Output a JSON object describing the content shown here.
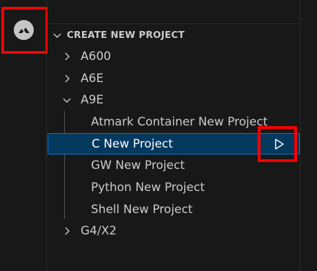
{
  "colors": {
    "background": "#181818",
    "text": "#cccccc",
    "selection_bg": "#04395e",
    "selection_border": "#0078d4",
    "annotation": "#ff0000"
  },
  "activity_bar": {
    "icon": "atmark-dev-icon"
  },
  "section": {
    "title": "CREATE NEW PROJECT",
    "icon": "chevron-down-icon"
  },
  "tree": [
    {
      "label": "A600",
      "expanded": false,
      "icon": "chevron-right-icon"
    },
    {
      "label": "A6E",
      "expanded": false,
      "icon": "chevron-right-icon"
    },
    {
      "label": "A9E",
      "expanded": true,
      "icon": "chevron-down-icon",
      "children": [
        {
          "label": "Atmark Container New Project"
        },
        {
          "label": "C New Project",
          "selected": true,
          "action_icon": "run-icon"
        },
        {
          "label": "GW New Project"
        },
        {
          "label": "Python New Project"
        },
        {
          "label": "Shell New Project"
        }
      ]
    },
    {
      "label": "G4/X2",
      "expanded": false,
      "icon": "chevron-right-icon"
    }
  ]
}
